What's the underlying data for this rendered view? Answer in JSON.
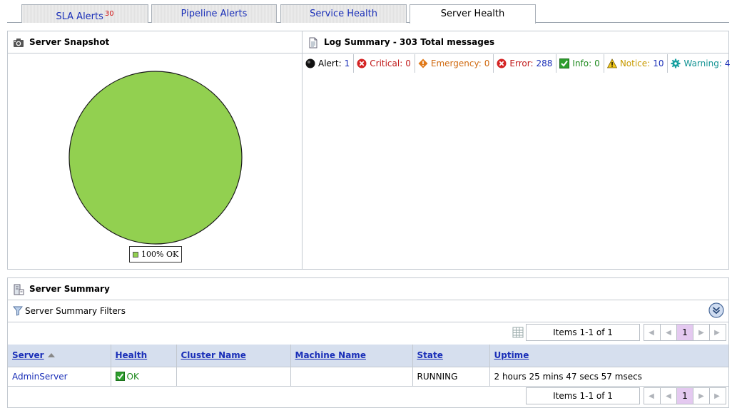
{
  "tabs": {
    "sla_alerts": {
      "label": "SLA Alerts",
      "badge": "30"
    },
    "pipeline_alerts": {
      "label": "Pipeline Alerts"
    },
    "service_health": {
      "label": "Service Health"
    },
    "server_health": {
      "label": "Server Health"
    }
  },
  "snapshot": {
    "title": "Server Snapshot",
    "pie": {
      "slices": [
        {
          "label": "100% OK",
          "value": 100,
          "color": "#92d050"
        }
      ]
    }
  },
  "log_summary": {
    "title": "Log Summary - 303 Total messages",
    "items": [
      {
        "label": "Alert:",
        "count": "1",
        "color": "#000000",
        "icon": "black-circle-icon"
      },
      {
        "label": "Critical:",
        "count": "0",
        "color": "#c01818",
        "icon": "red-x-circle-icon"
      },
      {
        "label": "Emergency:",
        "count": "0",
        "color": "#d06a10",
        "icon": "orange-diamond-icon"
      },
      {
        "label": "Error:",
        "count": "288",
        "color": "#c01818",
        "icon": "red-x-circle-icon"
      },
      {
        "label": "Info:",
        "count": "0",
        "color": "#1e8a1e",
        "icon": "green-check-icon"
      },
      {
        "label": "Notice:",
        "count": "10",
        "color": "#c89a00",
        "icon": "warning-triangle-icon"
      },
      {
        "label": "Warning:",
        "count": "4",
        "color": "#149494",
        "icon": "teal-gear-icon"
      }
    ]
  },
  "server_summary": {
    "title": "Server Summary",
    "filters_label": "Server Summary Filters",
    "pager": {
      "items_text": "Items 1-1 of 1",
      "current_page": "1"
    },
    "columns": [
      "Server",
      "Health",
      "Cluster Name",
      "Machine Name",
      "State",
      "Uptime"
    ],
    "rows": [
      {
        "server": "AdminServer",
        "health": "OK",
        "cluster": "",
        "machine": "",
        "state": "RUNNING",
        "uptime": "2 hours 25 mins 47 secs 57 msecs"
      }
    ]
  }
}
